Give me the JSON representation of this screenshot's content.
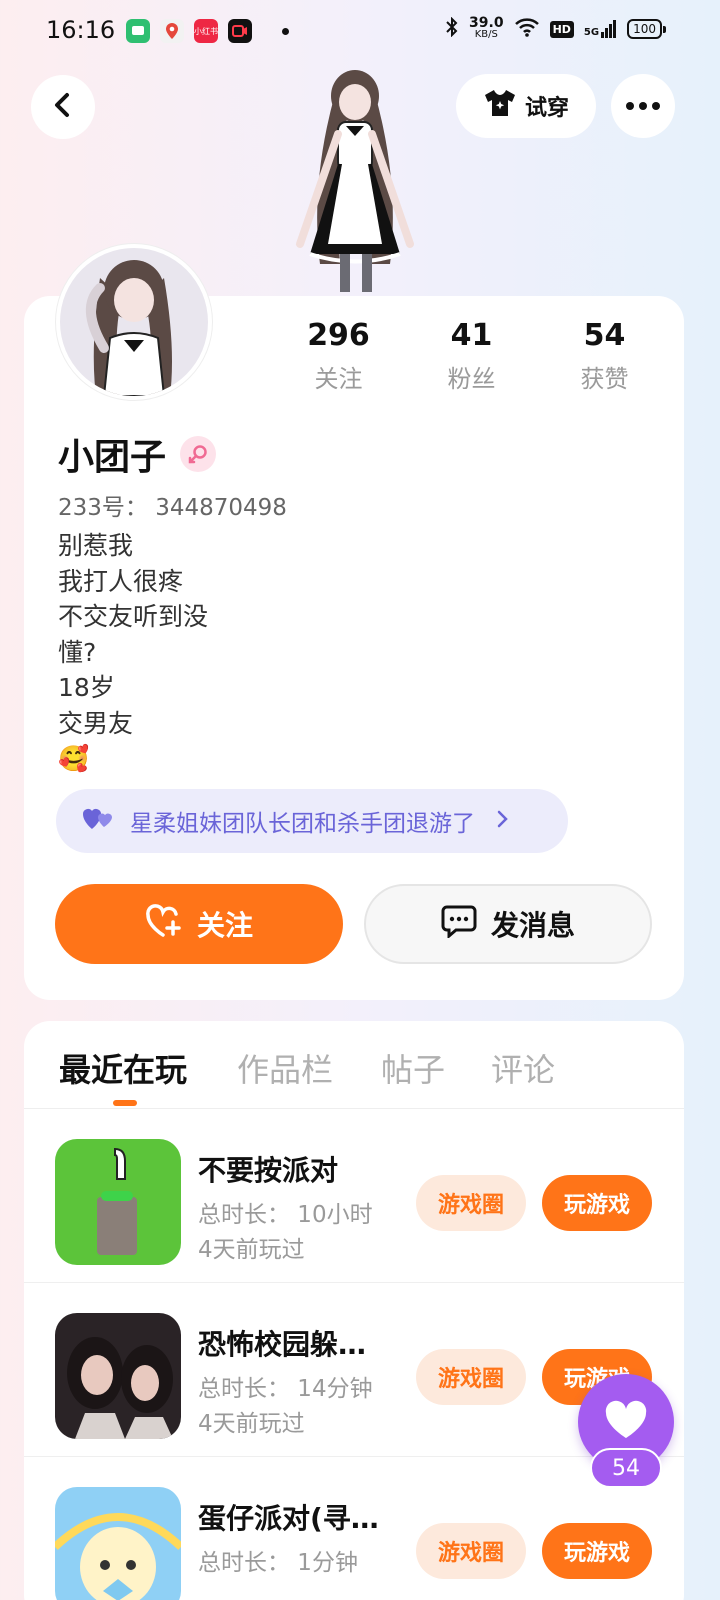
{
  "status_bar": {
    "time": "16:16",
    "net_speed": "39.0",
    "net_unit": "KB/S",
    "hd": "HD",
    "signal": "5G",
    "battery": "100",
    "app_label": "小红书"
  },
  "header": {
    "tryon_label": "试穿"
  },
  "profile": {
    "stats": [
      {
        "value": "296",
        "label": "关注"
      },
      {
        "value": "41",
        "label": "粉丝"
      },
      {
        "value": "54",
        "label": "获赞"
      }
    ],
    "nickname": "小团子",
    "uid": "233号： 344870498",
    "bio": [
      "别惹我",
      "我打人很疼",
      "不交友听到没",
      "懂?",
      "18岁",
      "交男友",
      "🥰"
    ],
    "group_text": "星柔姐妹团队长团和杀手团退游了",
    "follow_label": "关注",
    "message_label": "发消息"
  },
  "tabs": [
    "最近在玩",
    "作品栏",
    "帖子",
    "评论"
  ],
  "games": [
    {
      "title": "不要按派对",
      "duration": "总时长： 10小时",
      "last_played": "4天前玩过",
      "circle_label": "游戏圈",
      "play_label": "玩游戏"
    },
    {
      "title": "恐怖校园躲…",
      "duration": "总时长： 14分钟",
      "last_played": "4天前玩过",
      "circle_label": "游戏圈",
      "play_label": "玩游戏"
    },
    {
      "title": "蛋仔派对(寻…",
      "duration": "总时长： 1分钟",
      "last_played": "",
      "circle_label": "游戏圈",
      "play_label": "玩游戏"
    }
  ],
  "like_float": {
    "count": "54"
  },
  "colors": {
    "accent": "#ff7418",
    "accent_soft": "#fde9dc",
    "purple": "#a45cf0",
    "group_text": "#6a64d8"
  }
}
